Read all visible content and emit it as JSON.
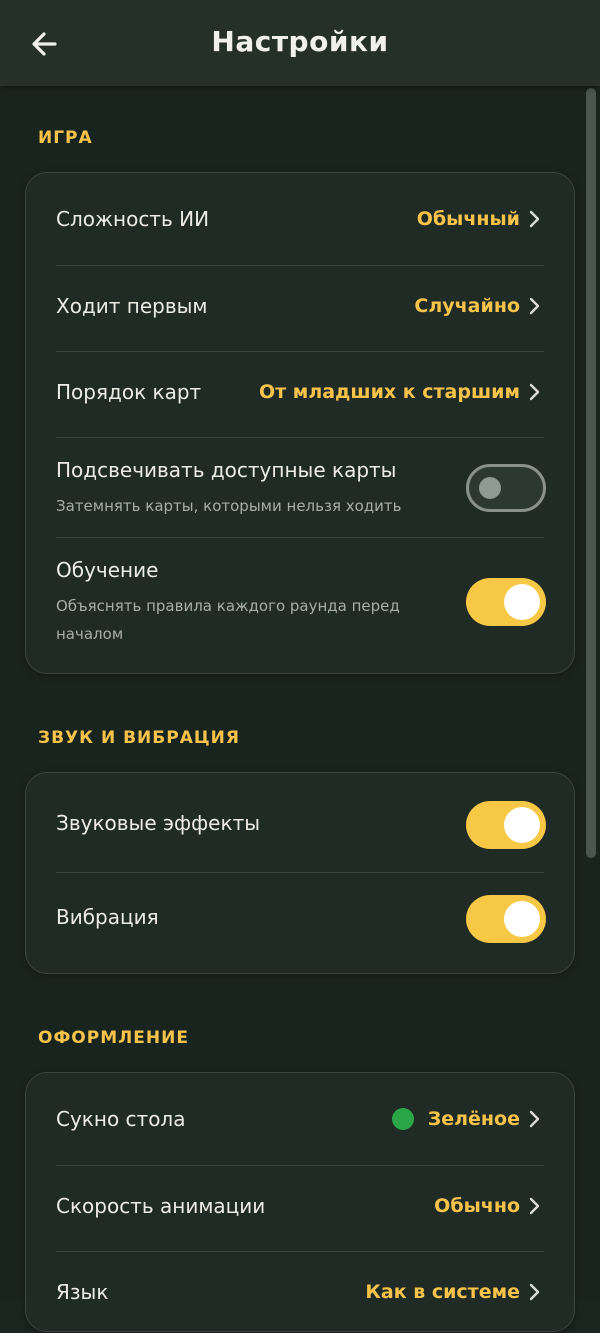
{
  "header": {
    "title": "Настройки",
    "back_icon": "arrow-left-icon"
  },
  "sections": {
    "game": {
      "title": "ИГРА",
      "difficulty": {
        "label": "Сложность ИИ",
        "value": "Обычный"
      },
      "first_move": {
        "label": "Ходит первым",
        "value": "Случайно"
      },
      "card_order": {
        "label": "Порядок карт",
        "value": "От младших к старшим"
      },
      "highlight": {
        "label": "Подсвечивать доступные карты",
        "sub": "Затемнять карты, которыми нельзя ходить",
        "enabled": false
      },
      "tutorial": {
        "label": "Обучение",
        "sub": "Объяснять правила каждого раунда перед началом",
        "enabled": true
      }
    },
    "sound": {
      "title": "ЗВУК И ВИБРАЦИЯ",
      "effects": {
        "label": "Звуковые эффекты",
        "enabled": true
      },
      "vibration": {
        "label": "Вибрация",
        "enabled": true
      }
    },
    "appearance": {
      "title": "ОФОРМЛЕНИЕ",
      "felt": {
        "label": "Сукно стола",
        "value": "Зелёное",
        "color": "#2aa548"
      },
      "anim_speed": {
        "label": "Скорость анимации",
        "value": "Обычно"
      },
      "language": {
        "label": "Язык",
        "value": "Как в системе"
      }
    }
  },
  "colors": {
    "accent": "#f7c34a",
    "background": "#1a241f",
    "card": "#212b25",
    "toggle_on": "#f7c846"
  }
}
